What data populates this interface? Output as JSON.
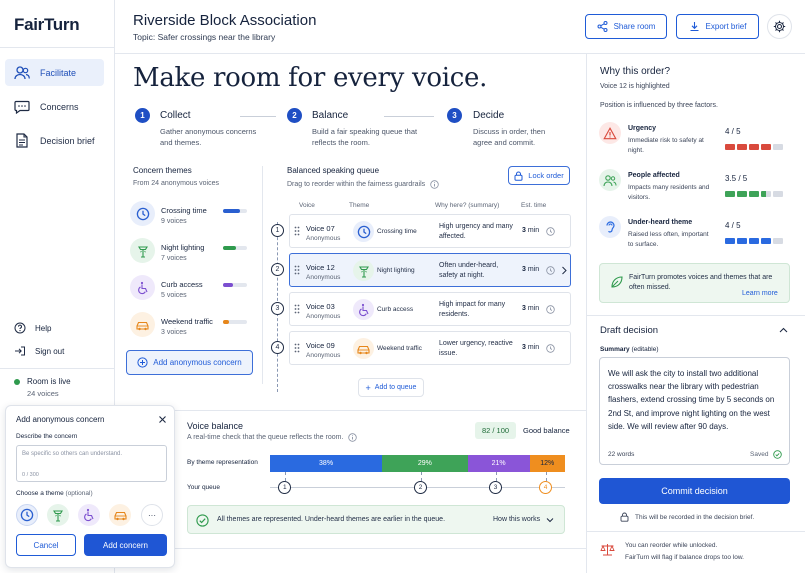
{
  "app": {
    "name": "FairTurn"
  },
  "sidebar": {
    "items": [
      {
        "label": "Facilitate",
        "icon": "users-icon",
        "active": true
      },
      {
        "label": "Concerns",
        "icon": "chat-bubble-icon",
        "active": false
      },
      {
        "label": "Decision brief",
        "icon": "document-icon",
        "active": false
      }
    ],
    "help": "Help",
    "signout": "Sign out",
    "status": "Room is live",
    "voices": "24 voices"
  },
  "header": {
    "title": "Riverside Block Association",
    "topic_label": "Topic:",
    "topic": "Safer crossings near the library",
    "share": "Share room",
    "export": "Export brief"
  },
  "hero": {
    "headline": "Make room for every voice.",
    "steps": [
      {
        "n": "1",
        "title": "Collect",
        "desc": "Gather anonymous concerns and themes."
      },
      {
        "n": "2",
        "title": "Balance",
        "desc": "Build a fair speaking queue that reflects the room."
      },
      {
        "n": "3",
        "title": "Decide",
        "desc": "Discuss in order, then agree and commit."
      }
    ]
  },
  "themes": {
    "title": "Concern themes",
    "subtitle": "From 24 anonymous voices",
    "items": [
      {
        "name": "Crossing time",
        "count": "9 voices",
        "icon": "clock-icon",
        "color": "#2a5fd0",
        "share": 0.7,
        "bg": "#e8eefb"
      },
      {
        "name": "Night lighting",
        "count": "7 voices",
        "icon": "streetlight-icon",
        "color": "#2f9a4d",
        "share": 0.55,
        "bg": "#e6f4ea"
      },
      {
        "name": "Curb access",
        "count": "5 voices",
        "icon": "wheelchair-icon",
        "color": "#7c4fd0",
        "share": 0.4,
        "bg": "#efe9fb"
      },
      {
        "name": "Weekend traffic",
        "count": "3 voices",
        "icon": "car-icon",
        "color": "#e6861a",
        "share": 0.25,
        "bg": "#fdf1e2"
      }
    ],
    "add": "Add anonymous concern"
  },
  "queue": {
    "title": "Balanced speaking queue",
    "subtitle": "Drag to reorder within the fairness guardrails",
    "lock": "Lock order",
    "columns": [
      "Voice",
      "Theme",
      "Why here? (summary)",
      "Est. time"
    ],
    "rows": [
      {
        "n": "1",
        "voice": "Voice 07",
        "anon": "Anonymous",
        "theme": "Crossing time",
        "icon": "clock-icon",
        "color": "#2a5fd0",
        "bg": "#e8eefb",
        "why": "High urgency and many affected.",
        "time": "3",
        "unit": "min",
        "highlight": false
      },
      {
        "n": "2",
        "voice": "Voice 12",
        "anon": "Anonymous",
        "theme": "Night lighting",
        "icon": "streetlight-icon",
        "color": "#2f9a4d",
        "bg": "#e6f4ea",
        "why": "Often under-heard, safety at night.",
        "time": "3",
        "unit": "min",
        "highlight": true
      },
      {
        "n": "3",
        "voice": "Voice 03",
        "anon": "Anonymous",
        "theme": "Curb access",
        "icon": "wheelchair-icon",
        "color": "#7c4fd0",
        "bg": "#efe9fb",
        "why": "High impact for many residents.",
        "time": "3",
        "unit": "min",
        "highlight": false
      },
      {
        "n": "4",
        "voice": "Voice 09",
        "anon": "Anonymous",
        "theme": "Weekend traffic",
        "icon": "car-icon",
        "color": "#e6861a",
        "bg": "#fdf1e2",
        "why": "Lower urgency, reactive issue.",
        "time": "3",
        "unit": "min",
        "highlight": false
      }
    ],
    "add": "Add to queue"
  },
  "balance": {
    "title": "Voice balance",
    "subtitle": "A real-time check that the queue reflects the room.",
    "score": "82 / 100",
    "score_label": "Good balance",
    "row1": "By theme representation",
    "row2": "Your queue",
    "segments": [
      {
        "label": "38%",
        "value": 38,
        "color": "#2a6ae0"
      },
      {
        "label": "29%",
        "value": 29,
        "color": "#3ea358"
      },
      {
        "label": "21%",
        "value": 21,
        "color": "#8a55d8"
      },
      {
        "label": "12%",
        "value": 12,
        "color": "#ef8e1f"
      }
    ],
    "markers": [
      "1",
      "2",
      "3",
      "4"
    ],
    "note": "All themes are represented. Under-heard themes are earlier in the queue.",
    "how": "How this works"
  },
  "why": {
    "title": "Why this order?",
    "highlight": "Voice 12 is highlighted",
    "influence": "Position is influenced by three factors.",
    "factors": [
      {
        "name": "Urgency",
        "desc": "Immediate risk to safety at night.",
        "score": "4 / 5",
        "filled": 4,
        "color": "#d94a3d",
        "icon": "warning-icon",
        "bg": "#fde8e6"
      },
      {
        "name": "People affected",
        "desc": "Impacts many residents and visitors.",
        "score": "3.5 / 5",
        "filled": 3.5,
        "color": "#3ea358",
        "icon": "people-icon",
        "bg": "#e6f4ea"
      },
      {
        "name": "Under-heard theme",
        "desc": "Raised less often, important to surface.",
        "score": "4 / 5",
        "filled": 4,
        "color": "#2a6ae0",
        "icon": "ear-icon",
        "bg": "#e8eefb"
      }
    ],
    "promo": "FairTurn promotes voices and themes that are often missed.",
    "learn": "Learn more"
  },
  "draft": {
    "title": "Draft decision",
    "summary_label": "Summary",
    "editable": "(editable)",
    "text": "We will ask the city to install two additional crosswalks near the library with pedestrian flashers, extend crossing time by 5 seconds on 2nd St, and improve night lighting on the west side. We will review after 90 days.",
    "words": "22 words",
    "saved": "Saved",
    "commit": "Commit decision",
    "record": "This will be recorded in the decision brief.",
    "reorder1": "You can reorder while unlocked.",
    "reorder2": "FairTurn will flag if balance drops too low."
  },
  "modal": {
    "title": "Add anonymous concern",
    "describe": "Describe the concern",
    "placeholder": "Be specific so others can understand.",
    "counter": "0 / 300",
    "choose": "Choose a theme",
    "optional": "(optional)",
    "more": "···",
    "cancel": "Cancel",
    "add": "Add concern"
  }
}
